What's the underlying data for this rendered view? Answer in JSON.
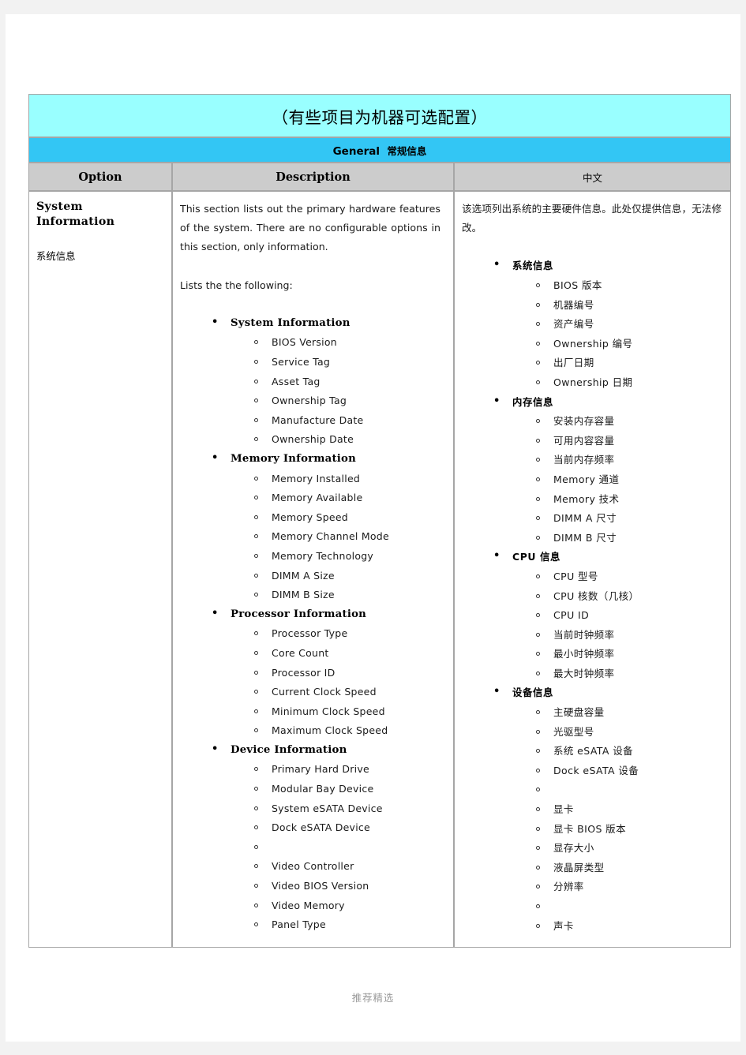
{
  "banner": {
    "title": "（有些项目为机器可选配置）",
    "section_en": "General",
    "section_zh": "常规信息"
  },
  "headers": {
    "option": "Option",
    "description": "Description",
    "chinese": "中文"
  },
  "row": {
    "option_en": "System Information",
    "option_zh": "系统信息",
    "description": {
      "para1": "This section lists out the primary hardware features of the system. There are no configurable options in this section, only information.",
      "para2": "Lists the the following:",
      "groups": [
        {
          "label": "System Information",
          "items": [
            "BIOS Version",
            "Service Tag",
            "Asset Tag",
            "Ownership Tag",
            "Manufacture Date",
            "Ownership Date"
          ]
        },
        {
          "label": "Memory Information",
          "items": [
            "Memory Installed",
            "Memory Available",
            "Memory Speed",
            "Memory Channel Mode",
            "Memory Technology",
            "DIMM A Size",
            "DIMM B Size"
          ]
        },
        {
          "label": "Processor Information",
          "items": [
            "Processor Type",
            "Core Count",
            "Processor ID",
            "Current Clock Speed",
            "Minimum Clock Speed",
            "Maximum Clock Speed"
          ]
        },
        {
          "label": "Device Information",
          "items": [
            "Primary Hard Drive",
            "Modular Bay Device",
            "System eSATA Device",
            "Dock eSATA Device",
            "",
            "Video Controller",
            "Video BIOS Version",
            "Video Memory",
            "Panel Type"
          ]
        }
      ]
    },
    "chinese": {
      "para1": "该选项列出系统的主要硬件信息。此处仅提供信息，无法修改。",
      "groups": [
        {
          "label": "系统信息",
          "items": [
            "BIOS 版本",
            "机器编号",
            "资产编号",
            "Ownership 编号",
            "出厂日期",
            "Ownership 日期"
          ]
        },
        {
          "label": "内存信息",
          "items": [
            "安装内存容量",
            "可用内容容量",
            "当前内存频率",
            "Memory 通道",
            "Memory 技术",
            "DIMM A 尺寸",
            "DIMM B 尺寸"
          ]
        },
        {
          "label": "CPU 信息",
          "items": [
            "CPU 型号",
            "CPU 核数（几核）",
            "CPU ID",
            "当前时钟频率",
            "最小时钟频率",
            "最大时钟频率"
          ]
        },
        {
          "label": "设备信息",
          "items": [
            "主硬盘容量",
            "光驱型号",
            "系统 eSATA 设备",
            "Dock eSATA  设备",
            "",
            "显卡",
            "显卡 BIOS 版本",
            "显存大小",
            "液晶屏类型",
            "分辨率",
            "",
            "声卡"
          ]
        }
      ]
    }
  },
  "footer": {
    "text": "推荐精选"
  },
  "colors": {
    "banner_title_bg": "#99ffff",
    "banner_section_bg": "#33c6f4",
    "header_bg": "#cccccc",
    "border": "#a6a6a6",
    "page_bg": "#f2f2f2",
    "footer_text": "#9a9a9a"
  }
}
